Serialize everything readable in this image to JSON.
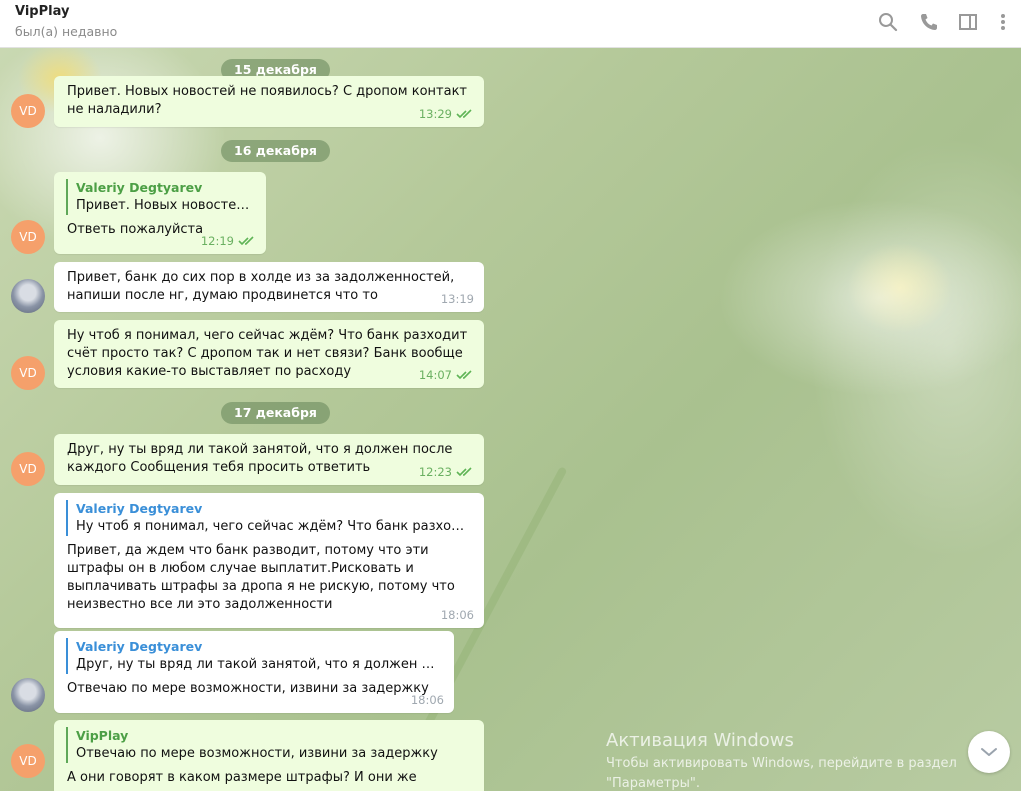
{
  "header": {
    "title": "VipPlay",
    "status": "был(а) недавно",
    "icons": [
      "search-icon",
      "phone-icon",
      "sidebar-icon",
      "more-icon"
    ]
  },
  "colors": {
    "outgoing": "#effdde",
    "incoming": "#ffffff",
    "accent_green": "#4c9f45",
    "accent_blue": "#3a8fd8",
    "avatar_vd": "#f5a06b"
  },
  "dates": [
    "15 декабря",
    "16 декабря",
    "17 декабря"
  ],
  "avatars": {
    "vd_initials": "VD"
  },
  "messages": [
    {
      "text": "Привет. Новых новостей не появилось? С дропом контакт не наладили?",
      "time": "13:29"
    },
    {
      "reply_name": "Valeriy Degtyarev",
      "reply_text": "Привет. Новых новостей н...",
      "text": "Ответь пожалуйста",
      "time": "12:19"
    },
    {
      "text": "Привет, банк до  сих пор в холде  из за задолженностей, напиши после нг, думаю продвинется что то",
      "time": "13:19"
    },
    {
      "text": "Ну чтоб я понимал, чего сейчас ждём? Что банк разходит счёт просто так? С дропом так и нет связи? Банк вообще условия какие-то выставляет по расходу",
      "time": "14:07"
    },
    {
      "text": "Друг, ну ты вряд ли такой занятой, что я должен после каждого Сообщения тебя просить ответить",
      "time": "12:23"
    },
    {
      "reply_name": "Valeriy Degtyarev",
      "reply_text": "Ну чтоб я понимал, чего сейчас ждём? Что банк разходит сч...",
      "text": "Привет, да ждем что банк разводит, потому что эти штрафы  он в любом случае выплатит.Рисковать и выплачивать  штрафы за дропа я не рискую, потому что неизвестно  все ли  это задолженности",
      "time": "18:06"
    },
    {
      "reply_name": "Valeriy Degtyarev",
      "reply_text": "Друг, ну ты вряд ли такой занятой, что я должен после к...",
      "text": "Отвечаю по мере возможности,  извини  за задержку",
      "time": "18:06"
    },
    {
      "reply_name": "VipPlay",
      "reply_text": "Отвечаю по мере возможности,  извини  за задержку",
      "text": "А они говорят в каком размере штрафы? И они же сказали что"
    }
  ],
  "activation": {
    "title": "Активация Windows",
    "text": "Чтобы активировать Windows, перейдите в раздел \"Параметры\"."
  }
}
